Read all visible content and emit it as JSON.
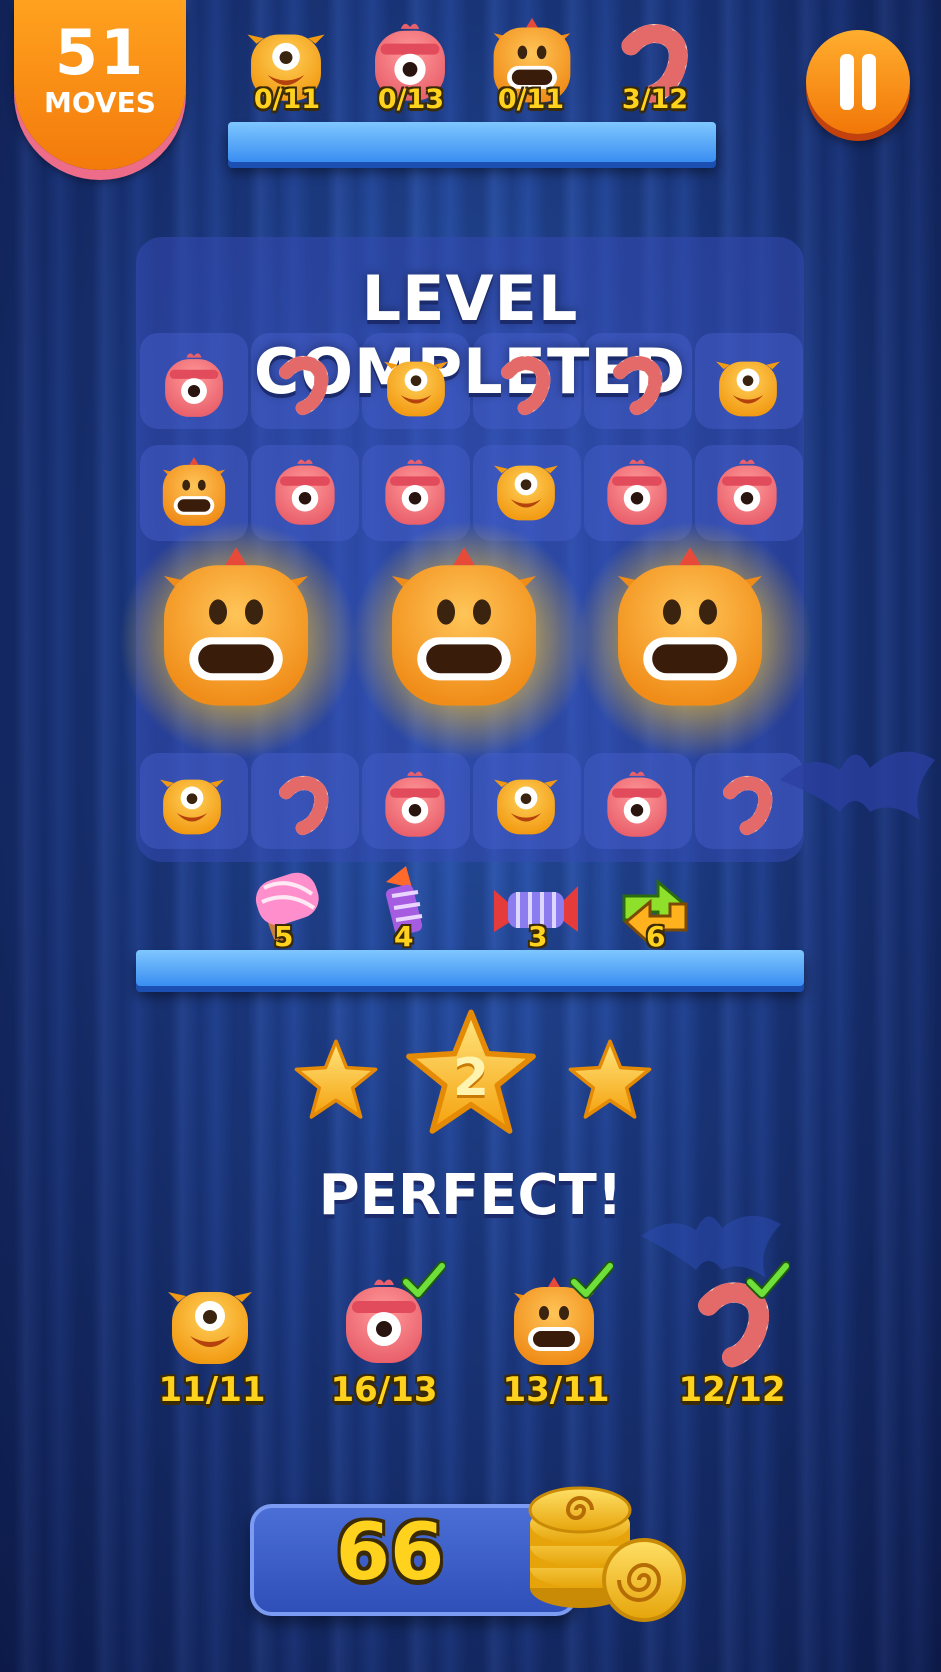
{
  "hud": {
    "moves_value": "51",
    "moves_label": "MOVES"
  },
  "goals": [
    {
      "icon": "yellow-cyclops-monster-icon",
      "count": "0/11"
    },
    {
      "icon": "pink-headband-monster-icon",
      "count": "0/13"
    },
    {
      "icon": "orange-screaming-monster-icon",
      "count": "0/11"
    },
    {
      "icon": "striped-candy-worm-icon",
      "count": "3/12"
    }
  ],
  "board": {
    "title": "LEVEL COMPLETED",
    "rows": [
      [
        "pink",
        "worm",
        "yellow",
        "worm",
        "worm",
        "yellow"
      ],
      [
        "orange",
        "pink",
        "pink",
        "yellow",
        "pink",
        "pink"
      ],
      [
        "big-orange",
        "big-orange",
        "big-orange"
      ],
      [
        "yellow",
        "worm",
        "pink",
        "yellow",
        "pink",
        "worm"
      ]
    ]
  },
  "boosters": [
    {
      "icon": "lollipop-hammer-icon",
      "count": "5"
    },
    {
      "icon": "firework-rocket-icon",
      "count": "4"
    },
    {
      "icon": "candy-wrapper-bomb-icon",
      "count": "3"
    },
    {
      "icon": "shuffle-arrows-icon",
      "count": "6"
    }
  ],
  "result": {
    "stars_earned": "2",
    "message": "PERFECT!",
    "goal_results": [
      {
        "icon": "yellow-cyclops-monster-icon",
        "count": "11/11",
        "completed": false
      },
      {
        "icon": "pink-headband-monster-icon",
        "count": "16/13",
        "completed": true
      },
      {
        "icon": "orange-screaming-monster-icon",
        "count": "13/11",
        "completed": true
      },
      {
        "icon": "striped-candy-worm-icon",
        "count": "12/12",
        "completed": true
      }
    ],
    "coins": "66"
  },
  "colors": {
    "accent_orange": "#f58a12",
    "gold_text": "#ffd21d",
    "shelf_blue": "#4aa3ff",
    "background_blue": "#1d3d8c"
  }
}
